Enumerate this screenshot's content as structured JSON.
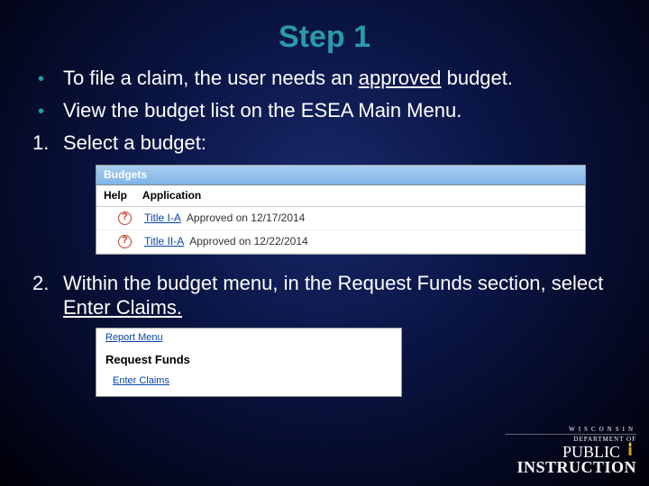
{
  "title": "Step 1",
  "bullets": [
    {
      "pre": "To file a claim, the user needs an ",
      "underlined": "approved",
      "post": " budget."
    },
    {
      "text": "View the budget list on the ESEA Main Menu."
    }
  ],
  "numbered": [
    {
      "num": "1.",
      "text": "Select a budget:"
    },
    {
      "num": "2.",
      "pre": "Within the budget menu, in the Request Funds section, select ",
      "underlined": "Enter Claims."
    }
  ],
  "screenshot1": {
    "header": "Budgets",
    "menu": [
      "Help",
      "Application"
    ],
    "rows": [
      {
        "link": "Title I-A",
        "status": "Approved on 12/17/2014"
      },
      {
        "link": "Title II-A",
        "status": "Approved on 12/22/2014"
      }
    ]
  },
  "screenshot2": {
    "topLink": "Report Menu",
    "heading": "Request Funds",
    "link": "Enter Claims"
  },
  "logo": {
    "state": "WISCONSIN",
    "dept": "DEPARTMENT OF",
    "word1": "PUBLIC",
    "word2": "INSTRUCTION"
  }
}
